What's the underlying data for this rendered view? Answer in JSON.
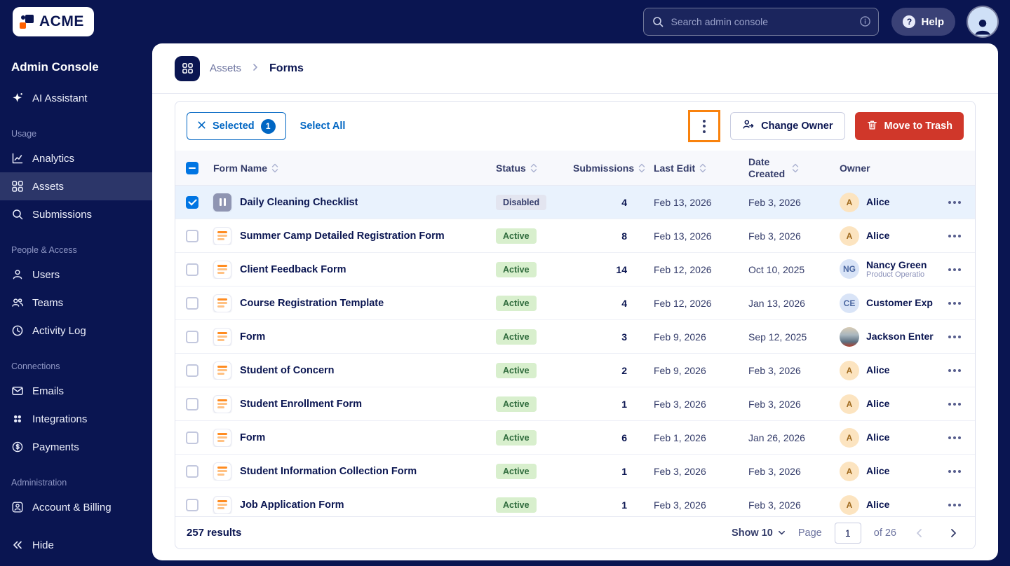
{
  "brand": {
    "name": "ACME"
  },
  "topbar": {
    "search": {
      "placeholder": "Search admin console"
    },
    "help_label": "Help"
  },
  "sidebar": {
    "title": "Admin Console",
    "assistant": {
      "label": "AI Assistant"
    },
    "sections": [
      {
        "label": "Usage",
        "items": [
          {
            "label": "Analytics",
            "icon": "analytics",
            "active": false
          },
          {
            "label": "Assets",
            "icon": "assets",
            "active": true
          },
          {
            "label": "Submissions",
            "icon": "search",
            "active": false
          }
        ]
      },
      {
        "label": "People & Access",
        "items": [
          {
            "label": "Users",
            "icon": "user",
            "active": false
          },
          {
            "label": "Teams",
            "icon": "team",
            "active": false
          },
          {
            "label": "Activity Log",
            "icon": "activity",
            "active": false
          }
        ]
      },
      {
        "label": "Connections",
        "items": [
          {
            "label": "Emails",
            "icon": "mail",
            "active": false
          },
          {
            "label": "Integrations",
            "icon": "integrations",
            "active": false
          },
          {
            "label": "Payments",
            "icon": "payments",
            "active": false
          }
        ]
      },
      {
        "label": "Administration",
        "items": [
          {
            "label": "Account & Billing",
            "icon": "billing",
            "active": false
          }
        ]
      }
    ],
    "hide_label": "Hide"
  },
  "breadcrumb": {
    "parent": "Assets",
    "current": "Forms"
  },
  "toolbar": {
    "selected_label": "Selected",
    "selected_count": "1",
    "select_all_label": "Select All",
    "change_owner_label": "Change Owner",
    "move_to_trash_label": "Move to Trash"
  },
  "table": {
    "columns": [
      {
        "key": "name",
        "label": "Form Name",
        "sortable": true
      },
      {
        "key": "status",
        "label": "Status",
        "sortable": true
      },
      {
        "key": "submissions",
        "label": "Submissions",
        "sortable": true
      },
      {
        "key": "last_edit",
        "label": "Last Edit",
        "sortable": true
      },
      {
        "key": "date_created",
        "label": "Date Created",
        "sortable": true
      },
      {
        "key": "owner",
        "label": "Owner",
        "sortable": false
      }
    ],
    "rows": [
      {
        "name": "Daily Cleaning Checklist",
        "icon": "disabled",
        "status": "Disabled",
        "submissions": "4",
        "last_edit": "Feb 13, 2026",
        "date_created": "Feb 3, 2026",
        "selected": true,
        "owner": {
          "initials": "A",
          "name": "Alice",
          "subtitle": "",
          "avatar": "peach"
        }
      },
      {
        "name": "Summer Camp Detailed Registration Form",
        "icon": "form",
        "status": "Active",
        "submissions": "8",
        "last_edit": "Feb 13, 2026",
        "date_created": "Feb 3, 2026",
        "selected": false,
        "owner": {
          "initials": "A",
          "name": "Alice",
          "subtitle": "",
          "avatar": "peach"
        }
      },
      {
        "name": "Client Feedback Form",
        "icon": "form",
        "status": "Active",
        "submissions": "14",
        "last_edit": "Feb 12, 2026",
        "date_created": "Oct 10, 2025",
        "selected": false,
        "owner": {
          "initials": "NG",
          "name": "Nancy Green",
          "subtitle": "Product Operatio",
          "avatar": "blue"
        }
      },
      {
        "name": "Course Registration Template",
        "icon": "form",
        "status": "Active",
        "submissions": "4",
        "last_edit": "Feb 12, 2026",
        "date_created": "Jan 13, 2026",
        "selected": false,
        "owner": {
          "initials": "CE",
          "name": "Customer Exp",
          "subtitle": "",
          "avatar": "blue"
        }
      },
      {
        "name": "Form",
        "icon": "form",
        "status": "Active",
        "submissions": "3",
        "last_edit": "Feb 9, 2026",
        "date_created": "Sep 12, 2025",
        "selected": false,
        "owner": {
          "initials": "",
          "name": "Jackson Enter",
          "subtitle": "",
          "avatar": "photo"
        }
      },
      {
        "name": "Student of Concern",
        "icon": "form",
        "status": "Active",
        "submissions": "2",
        "last_edit": "Feb 9, 2026",
        "date_created": "Feb 3, 2026",
        "selected": false,
        "owner": {
          "initials": "A",
          "name": "Alice",
          "subtitle": "",
          "avatar": "peach"
        }
      },
      {
        "name": "Student Enrollment Form",
        "icon": "form",
        "status": "Active",
        "submissions": "1",
        "last_edit": "Feb 3, 2026",
        "date_created": "Feb 3, 2026",
        "selected": false,
        "owner": {
          "initials": "A",
          "name": "Alice",
          "subtitle": "",
          "avatar": "peach"
        }
      },
      {
        "name": "Form",
        "icon": "form",
        "status": "Active",
        "submissions": "6",
        "last_edit": "Feb 1, 2026",
        "date_created": "Jan 26, 2026",
        "selected": false,
        "owner": {
          "initials": "A",
          "name": "Alice",
          "subtitle": "",
          "avatar": "peach"
        }
      },
      {
        "name": "Student Information Collection Form",
        "icon": "form",
        "status": "Active",
        "submissions": "1",
        "last_edit": "Feb 3, 2026",
        "date_created": "Feb 3, 2026",
        "selected": false,
        "owner": {
          "initials": "A",
          "name": "Alice",
          "subtitle": "",
          "avatar": "peach"
        }
      },
      {
        "name": "Job Application Form",
        "icon": "form",
        "status": "Active",
        "submissions": "1",
        "last_edit": "Feb 3, 2026",
        "date_created": "Feb 3, 2026",
        "selected": false,
        "owner": {
          "initials": "A",
          "name": "Alice",
          "subtitle": "",
          "avatar": "peach"
        }
      }
    ]
  },
  "footer": {
    "results_label": "257 results",
    "show_label": "Show 10",
    "page_label": "Page",
    "page_value": "1",
    "of_label": "of 26"
  },
  "colors": {
    "navy": "#0a1551",
    "link_blue": "#0066c3",
    "checkbox_blue": "#0075e3",
    "highlight_orange": "#f9820d",
    "form_icon_orange": "#ff8c21",
    "danger_red": "#d0372a",
    "active_badge_bg": "#d8efcd",
    "active_badge_text": "#2f6b3c",
    "disabled_badge_bg": "#e3e5f0",
    "selected_row_bg": "#e9f2fd"
  }
}
